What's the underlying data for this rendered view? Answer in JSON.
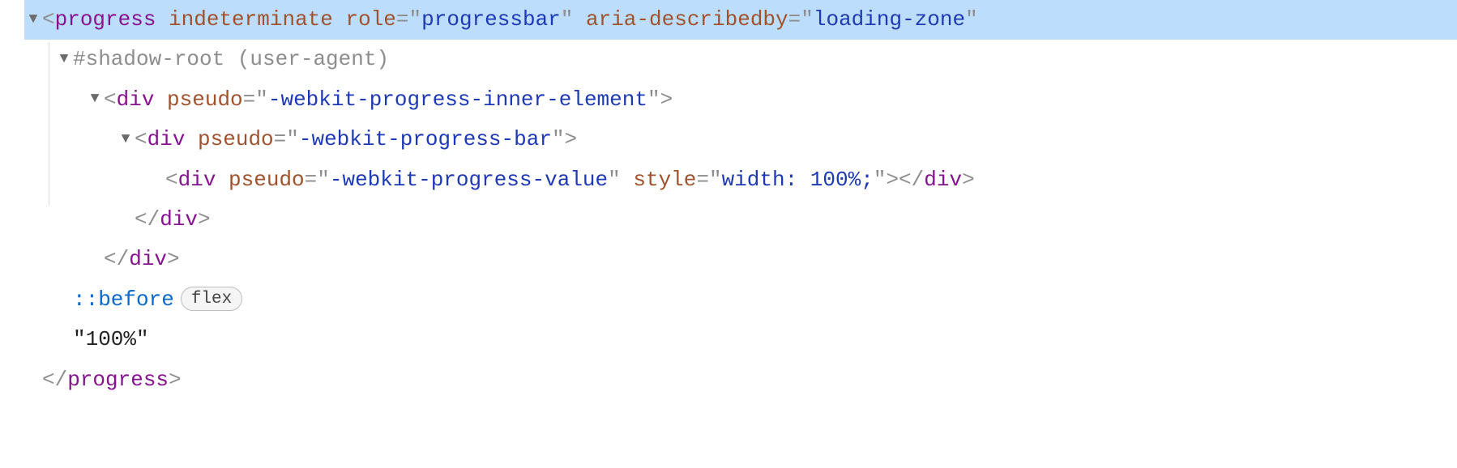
{
  "line0": {
    "tag": "progress",
    "attr1": "indeterminate",
    "attr2_name": "role",
    "attr2_val": "progressbar",
    "attr3_name": "aria-describedby",
    "attr3_val": "loading-zone"
  },
  "line1": {
    "text": "#shadow-root (user-agent)"
  },
  "line2": {
    "tag": "div",
    "attr_name": "pseudo",
    "attr_val": "-webkit-progress-inner-element"
  },
  "line3": {
    "tag": "div",
    "attr_name": "pseudo",
    "attr_val": "-webkit-progress-bar"
  },
  "line4": {
    "tag": "div",
    "attr1_name": "pseudo",
    "attr1_val": "-webkit-progress-value",
    "attr2_name": "style",
    "attr2_val": "width: 100%;",
    "close": "div"
  },
  "line5": {
    "close": "div"
  },
  "line6": {
    "close": "div"
  },
  "line7": {
    "pseudo": "::before",
    "chip": "flex"
  },
  "line8": {
    "text": "\"100%\""
  },
  "line9": {
    "close": "progress"
  }
}
